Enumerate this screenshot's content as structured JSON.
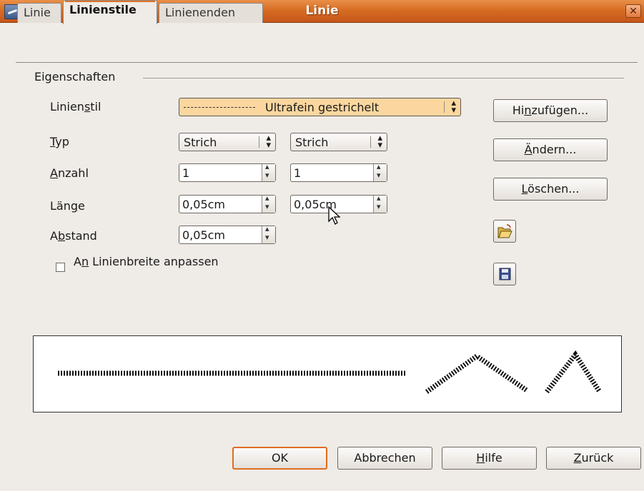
{
  "window": {
    "title": "Linie",
    "close_icon": "close-icon"
  },
  "tabs": [
    {
      "label": "Linie",
      "active": false
    },
    {
      "label": "Linienstile",
      "active": true
    },
    {
      "label": "Linienenden",
      "active": false
    }
  ],
  "group": {
    "label": "Eigenschaften"
  },
  "fields": {
    "linienstil": {
      "label_pre": "Linien",
      "label_mn": "s",
      "label_post": "til",
      "value": "Ultrafein gestrichelt"
    },
    "typ": {
      "label_mn": "T",
      "label_post": "yp",
      "value1": "Strich",
      "value2": "Strich"
    },
    "anzahl": {
      "label_mn": "A",
      "label_post": "nzahl",
      "value1": "1",
      "value2": "1"
    },
    "laenge": {
      "label_pre": "Län",
      "label_mn": "g",
      "label_post": "e",
      "value1": "0,05cm",
      "value2": "0,05cm"
    },
    "abstand": {
      "label_pre": "A",
      "label_mn": "b",
      "label_post": "stand",
      "value": "0,05cm"
    }
  },
  "checkbox": {
    "label_pre": "A",
    "label_mn": "n",
    "label_post": " Linienbreite anpassen",
    "checked": false
  },
  "side_buttons": {
    "add": {
      "pre": "Hi",
      "mn": "n",
      "post": "zufügen..."
    },
    "modify": {
      "pre": "",
      "mn": "Ä",
      "post": "ndern..."
    },
    "delete": {
      "pre": "",
      "mn": "L",
      "post": "öschen..."
    },
    "open_icon": "folder-open-icon",
    "save_icon": "floppy-save-icon"
  },
  "bottom_buttons": {
    "ok": "OK",
    "cancel": "Abbrechen",
    "help": {
      "mn": "H",
      "post": "ilfe"
    },
    "back": {
      "mn": "Z",
      "post": "urück"
    }
  },
  "colors": {
    "titlebar": "#d76d23",
    "accent": "#e06d1f",
    "highlight": "#fbd79f"
  }
}
